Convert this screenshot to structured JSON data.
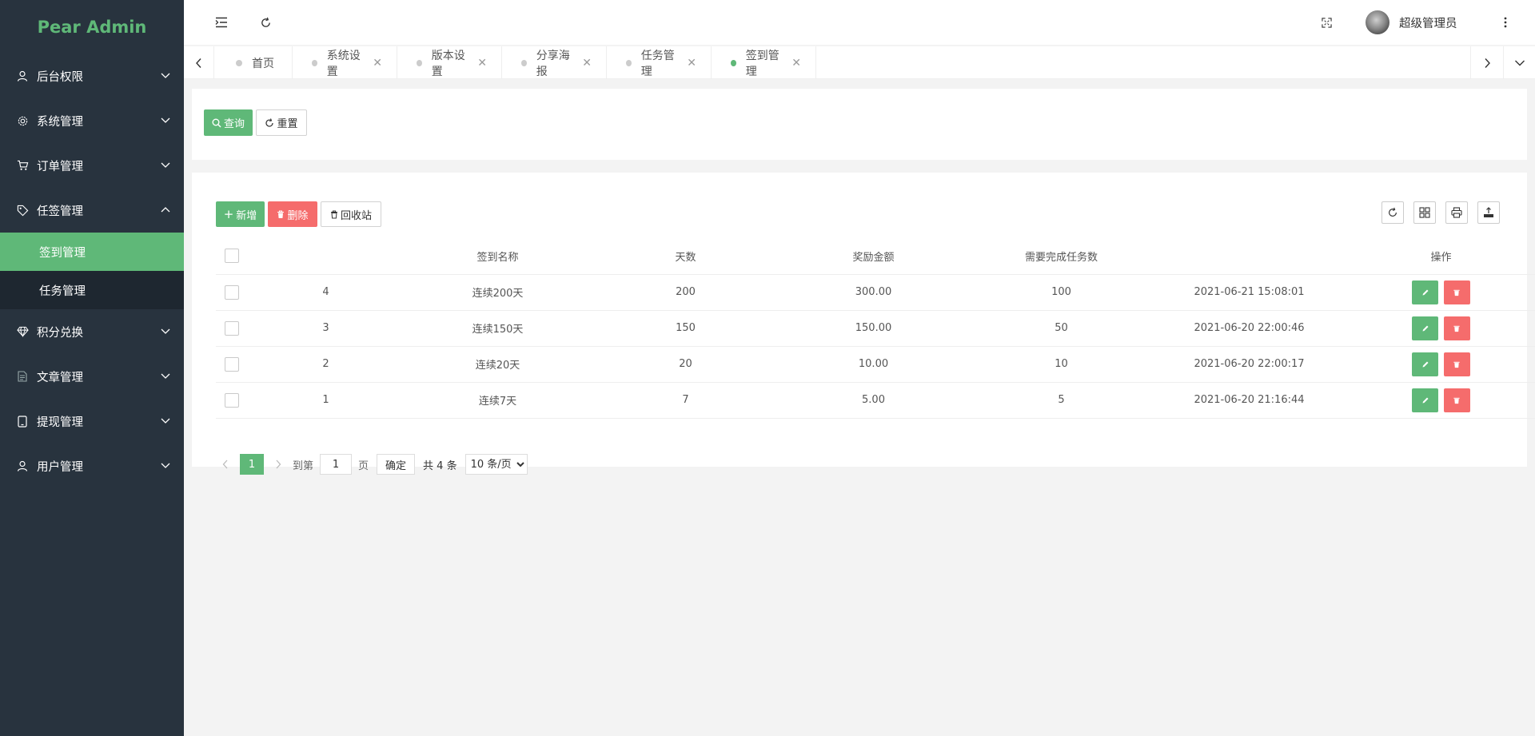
{
  "app": {
    "logo": "Pear Admin"
  },
  "sidebar": {
    "items": [
      {
        "label": "后台权限",
        "icon": "user-icon"
      },
      {
        "label": "系统管理",
        "icon": "gear-icon"
      },
      {
        "label": "订单管理",
        "icon": "cart-icon"
      },
      {
        "label": "任签管理",
        "icon": "tag-icon",
        "expanded": true,
        "children": [
          {
            "label": "签到管理",
            "active": true
          },
          {
            "label": "任务管理"
          }
        ]
      },
      {
        "label": "积分兑换",
        "icon": "diamond-icon"
      },
      {
        "label": "文章管理",
        "icon": "document-icon"
      },
      {
        "label": "提现管理",
        "icon": "tablet-icon"
      },
      {
        "label": "用户管理",
        "icon": "user-icon"
      }
    ]
  },
  "header": {
    "username": "超级管理员"
  },
  "tabs": [
    {
      "label": "首页"
    },
    {
      "label": "系统设置"
    },
    {
      "label": "版本设置"
    },
    {
      "label": "分享海报"
    },
    {
      "label": "任务管理"
    },
    {
      "label": "签到管理",
      "active": true
    }
  ],
  "search": {
    "query_label": "查询",
    "reset_label": "重置"
  },
  "toolbar": {
    "add_label": "新增",
    "delete_label": "删除",
    "recycle_label": "回收站"
  },
  "table": {
    "headers": [
      "",
      "",
      "签到名称",
      "天数",
      "奖励金额",
      "需要完成任务数",
      "",
      "操作"
    ],
    "rows": [
      {
        "id": "4",
        "name": "连续200天",
        "days": "200",
        "reward": "300.00",
        "tasks": "100",
        "time": "2021-06-21 15:08:01"
      },
      {
        "id": "3",
        "name": "连续150天",
        "days": "150",
        "reward": "150.00",
        "tasks": "50",
        "time": "2021-06-20 22:00:46"
      },
      {
        "id": "2",
        "name": "连续20天",
        "days": "20",
        "reward": "10.00",
        "tasks": "10",
        "time": "2021-06-20 22:00:17"
      },
      {
        "id": "1",
        "name": "连续7天",
        "days": "7",
        "reward": "5.00",
        "tasks": "5",
        "time": "2021-06-20 21:16:44"
      }
    ]
  },
  "pagination": {
    "current_page": "1",
    "goto_prefix": "到第",
    "goto_value": "1",
    "goto_suffix": "页",
    "confirm_label": "确定",
    "total_label": "共 4 条",
    "page_size_label": "10 条/页"
  },
  "colors": {
    "primary": "#5fb878",
    "danger": "#f56c6c",
    "sidebar_bg": "#28333e",
    "submenu_bg": "#1e2730"
  }
}
